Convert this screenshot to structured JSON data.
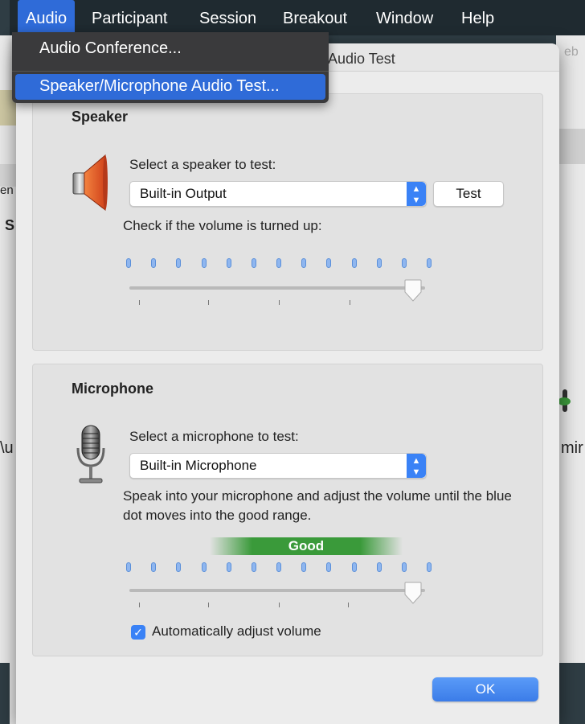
{
  "menubar": {
    "items": [
      {
        "label": "Audio",
        "active": true
      },
      {
        "label": "Participant"
      },
      {
        "label": "Session"
      },
      {
        "label": "Breakout"
      },
      {
        "label": "Window"
      },
      {
        "label": "Help"
      }
    ]
  },
  "dropdown": {
    "items": [
      {
        "label": "Audio Conference..."
      },
      {
        "label": "Speaker/Microphone Audio Test...",
        "highlighted": true
      }
    ]
  },
  "background": {
    "left_fragment_1": "en",
    "left_fragment_2": "S",
    "left_fragment_3": "\\u",
    "right_fragment_1": "eb",
    "right_fragment_2": "mir"
  },
  "dialog": {
    "title": "Audio Test",
    "speaker": {
      "section_title": "Speaker",
      "select_label": "Select a speaker to test:",
      "selected_device": "Built-in Output",
      "test_button": "Test",
      "volume_label": "Check if the volume is turned up:",
      "volume_level": 0.96,
      "meter_dots": 13,
      "icon": "speaker-icon"
    },
    "microphone": {
      "section_title": "Microphone",
      "select_label": "Select a microphone to test:",
      "selected_device": "Built-in Microphone",
      "instructions": "Speak into your microphone and adjust the volume until the blue dot moves into the good range.",
      "good_label": "Good",
      "volume_level": 0.96,
      "meter_dots": 13,
      "auto_adjust_label": "Automatically adjust volume",
      "auto_adjust_checked": true,
      "icon": "microphone-icon"
    },
    "ok_button": "OK"
  },
  "colors": {
    "accent": "#2f6bd8",
    "good": "#3a9a3a",
    "menubar": "#1f2a30"
  }
}
